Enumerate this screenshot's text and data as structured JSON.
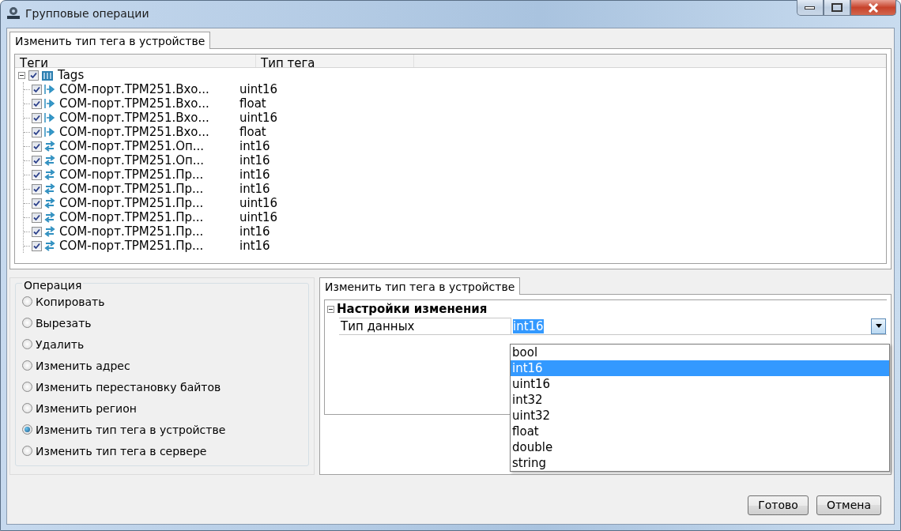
{
  "window": {
    "title": "Групповые операции"
  },
  "top_tab": {
    "label": "Изменить тип тега в устройстве",
    "selected": true
  },
  "tree": {
    "columns": [
      "Теги",
      "Тип тега"
    ],
    "root": {
      "label": "Tags",
      "checked": true,
      "expanded": true,
      "children": [
        {
          "name": "COM-порт.ТРМ251.Вхо...",
          "type": "uint16",
          "checked": true,
          "kind": "input"
        },
        {
          "name": "COM-порт.ТРМ251.Вхо...",
          "type": "float",
          "checked": true,
          "kind": "input"
        },
        {
          "name": "COM-порт.ТРМ251.Вхо...",
          "type": "uint16",
          "checked": true,
          "kind": "input"
        },
        {
          "name": "COM-порт.ТРМ251.Вхо...",
          "type": "float",
          "checked": true,
          "kind": "input"
        },
        {
          "name": "COM-порт.ТРМ251.Оп...",
          "type": "int16",
          "checked": true,
          "kind": "exchange"
        },
        {
          "name": "COM-порт.ТРМ251.Оп...",
          "type": "int16",
          "checked": true,
          "kind": "exchange"
        },
        {
          "name": "COM-порт.ТРМ251.Пр...",
          "type": "int16",
          "checked": true,
          "kind": "exchange"
        },
        {
          "name": "COM-порт.ТРМ251.Пр...",
          "type": "int16",
          "checked": true,
          "kind": "exchange"
        },
        {
          "name": "COM-порт.ТРМ251.Пр...",
          "type": "uint16",
          "checked": true,
          "kind": "exchange"
        },
        {
          "name": "COM-порт.ТРМ251.Пр...",
          "type": "uint16",
          "checked": true,
          "kind": "exchange"
        },
        {
          "name": "COM-порт.ТРМ251.Пр...",
          "type": "int16",
          "checked": true,
          "kind": "exchange"
        },
        {
          "name": "COM-порт.ТРМ251.Пр...",
          "type": "int16",
          "checked": true,
          "kind": "exchange"
        }
      ]
    }
  },
  "operation": {
    "title": "Операция",
    "options": [
      {
        "label": "Копировать",
        "selected": false
      },
      {
        "label": "Вырезать",
        "selected": false
      },
      {
        "label": "Удалить",
        "selected": false
      },
      {
        "label": "Изменить адрес",
        "selected": false
      },
      {
        "label": "Изменить перестановку байтов",
        "selected": false
      },
      {
        "label": "Изменить регион",
        "selected": false
      },
      {
        "label": "Изменить тип тега в устройстве",
        "selected": true
      },
      {
        "label": "Изменить тип тега в сервере",
        "selected": false
      }
    ]
  },
  "settings": {
    "tab": {
      "label": "Изменить тип тега в устройстве",
      "selected": true
    },
    "section": {
      "label": "Настройки изменения",
      "expanded": true
    },
    "property": {
      "label": "Тип данных",
      "value": "int16"
    },
    "dropdown": {
      "open": true,
      "options": [
        {
          "label": "bool",
          "selected": false
        },
        {
          "label": "int16",
          "selected": true
        },
        {
          "label": "uint16",
          "selected": false
        },
        {
          "label": "int32",
          "selected": false
        },
        {
          "label": "uint32",
          "selected": false
        },
        {
          "label": "float",
          "selected": false
        },
        {
          "label": "double",
          "selected": false
        },
        {
          "label": "string",
          "selected": false
        }
      ]
    }
  },
  "buttons": [
    "Готово",
    "Отмена"
  ]
}
